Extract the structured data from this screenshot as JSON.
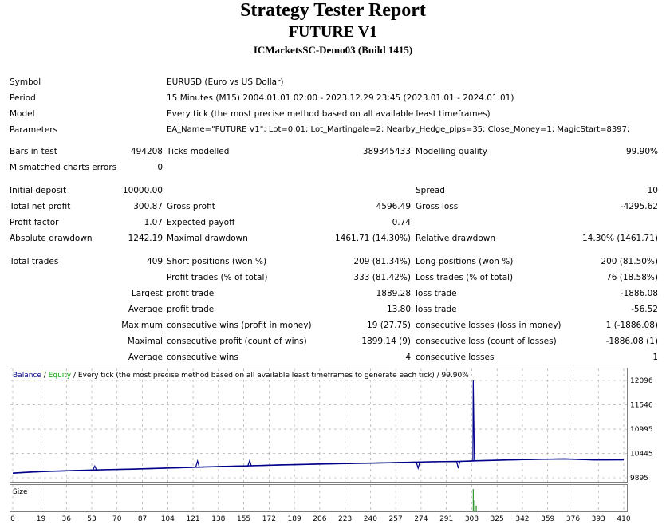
{
  "header": {
    "title": "Strategy Tester Report",
    "subtitle": "FUTURE V1",
    "server": "ICMarketsSC-Demo03 (Build 1415)"
  },
  "info": {
    "symbol_label": "Symbol",
    "symbol_value": "EURUSD (Euro vs US Dollar)",
    "period_label": "Period",
    "period_value": "15 Minutes (M15) 2004.01.01 02:00 - 2023.12.29 23:45 (2023.01.01 - 2024.01.01)",
    "model_label": "Model",
    "model_value": "Every tick (the most precise method based on all available least timeframes)",
    "params_label": "Parameters",
    "params_value": "EA_Name=\"FUTURE V1\"; Lot=0.01; Lot_Martingale=2; Nearby_Hedge_pips=35; Close_Money=1; MagicStart=8397;"
  },
  "bars": {
    "bars_label": "Bars in test",
    "bars_value": "494208",
    "ticks_label": "Ticks modelled",
    "ticks_value": "389345433",
    "quality_label": "Modelling quality",
    "quality_value": "99.90%",
    "mismatch_label": "Mismatched charts errors",
    "mismatch_value": "0"
  },
  "results": {
    "deposit_label": "Initial deposit",
    "deposit_value": "10000.00",
    "spread_label": "Spread",
    "spread_value": "10",
    "net_label": "Total net profit",
    "net_value": "300.87",
    "gross_profit_label": "Gross profit",
    "gross_profit_value": "4596.49",
    "gross_loss_label": "Gross loss",
    "gross_loss_value": "-4295.62",
    "pf_label": "Profit factor",
    "pf_value": "1.07",
    "payoff_label": "Expected payoff",
    "payoff_value": "0.74",
    "abs_dd_label": "Absolute drawdown",
    "abs_dd_value": "1242.19",
    "max_dd_label": "Maximal drawdown",
    "max_dd_value": "1461.71 (14.30%)",
    "rel_dd_label": "Relative drawdown",
    "rel_dd_value": "14.30% (1461.71)"
  },
  "trades": {
    "total_label": "Total trades",
    "total_value": "409",
    "short_label": "Short positions (won %)",
    "short_value": "209 (81.34%)",
    "long_label": "Long positions (won %)",
    "long_value": "200 (81.50%)",
    "profit_trades_label": "Profit trades (% of total)",
    "profit_trades_value": "333 (81.42%)",
    "loss_trades_label": "Loss trades (% of total)",
    "loss_trades_value": "76 (18.58%)",
    "largest_label": "Largest",
    "largest_profit_label": "profit trade",
    "largest_profit_value": "1889.28",
    "largest_loss_label": "loss trade",
    "largest_loss_value": "-1886.08",
    "average_label": "Average",
    "average_profit_label": "profit trade",
    "average_profit_value": "13.80",
    "average_loss_label": "loss trade",
    "average_loss_value": "-56.52",
    "maximum_label": "Maximum",
    "max_wins_label": "consecutive wins (profit in money)",
    "max_wins_value": "19 (27.75)",
    "max_losses_label": "consecutive losses (loss in money)",
    "max_losses_value": "1 (-1886.08)",
    "maximal_label": "Maximal",
    "maximal_profit_label": "consecutive profit (count of wins)",
    "maximal_profit_value": "1899.14 (9)",
    "maximal_loss_label": "consecutive loss (count of losses)",
    "maximal_loss_value": "-1886.08 (1)",
    "avg_label": "Average",
    "avg_wins_label": "consecutive wins",
    "avg_wins_value": "4",
    "avg_losses_label": "consecutive losses",
    "avg_losses_value": "1"
  },
  "chart_data": {
    "type": "line",
    "legend": {
      "balance": "Balance",
      "sep1": " / ",
      "equity": "Equity",
      "rest": " / Every tick (the most precise method based on all available least timeframes to generate each tick) / 99.90%"
    },
    "size_label": "Size",
    "y_ticks": [
      12096,
      11546,
      10995,
      10445,
      9895
    ],
    "x_ticks": [
      0,
      19,
      36,
      53,
      70,
      87,
      104,
      121,
      138,
      155,
      172,
      189,
      206,
      223,
      240,
      257,
      274,
      291,
      308,
      325,
      342,
      359,
      376,
      393,
      410
    ],
    "ylim": [
      9895,
      12096
    ],
    "xlim": [
      0,
      410
    ],
    "balance": [
      [
        0,
        10000
      ],
      [
        10,
        10020
      ],
      [
        20,
        10035
      ],
      [
        40,
        10055
      ],
      [
        60,
        10075
      ],
      [
        80,
        10090
      ],
      [
        100,
        10110
      ],
      [
        120,
        10130
      ],
      [
        140,
        10150
      ],
      [
        160,
        10165
      ],
      [
        180,
        10185
      ],
      [
        200,
        10200
      ],
      [
        220,
        10215
      ],
      [
        240,
        10225
      ],
      [
        260,
        10240
      ],
      [
        280,
        10255
      ],
      [
        300,
        10265
      ],
      [
        305,
        10270
      ],
      [
        312,
        10280
      ],
      [
        330,
        10295
      ],
      [
        350,
        10310
      ],
      [
        370,
        10320
      ],
      [
        390,
        10300
      ],
      [
        410,
        10301
      ]
    ],
    "equity_spikes": [
      [
        55,
        10160
      ],
      [
        124,
        10275
      ],
      [
        159,
        10290
      ],
      [
        272,
        10110
      ],
      [
        299,
        10110
      ],
      [
        309,
        12096
      ],
      [
        310,
        10420
      ],
      [
        311,
        10280
      ]
    ],
    "size_bars": [
      [
        309,
        1.0
      ],
      [
        310,
        0.5
      ],
      [
        311,
        0.25
      ]
    ],
    "colors": {
      "balance": "#00008b",
      "equity": "#00a000",
      "size": "#008000",
      "grid": "#a0a0a0"
    }
  }
}
